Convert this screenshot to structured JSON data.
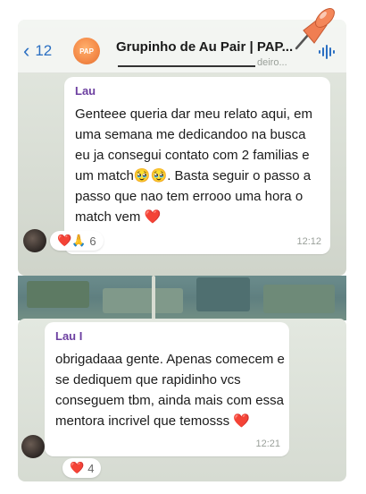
{
  "header": {
    "back_count": "12",
    "group_title": "Grupinho de Au Pair | PAP...",
    "group_subtitle": "deiro...",
    "avatar_label": "PAP"
  },
  "message1": {
    "sender": "Lau",
    "text": "Genteee queria dar meu relato aqui, em uma semana me dedicandoo na busca eu ja consegui contato com 2 familias e um match🥹🥹. Basta seguir o passo a passo que nao tem errooo uma hora o match vem ❤️",
    "time": "12:12",
    "reactions": "❤️🙏",
    "reaction_count": "6"
  },
  "message2": {
    "sender": "Lau I",
    "text": "obrigadaaa gente. Apenas comecem e se dediquem que rapidinho vcs conseguem tbm, ainda mais com essa mentora incrivel que temosss ❤️",
    "time": "12:21",
    "reactions": "❤️",
    "reaction_count": "4"
  },
  "colors": {
    "accent_blue": "#2b6fc2",
    "sender_purple": "#6c3fa0",
    "pin_orange": "#f07e52"
  }
}
